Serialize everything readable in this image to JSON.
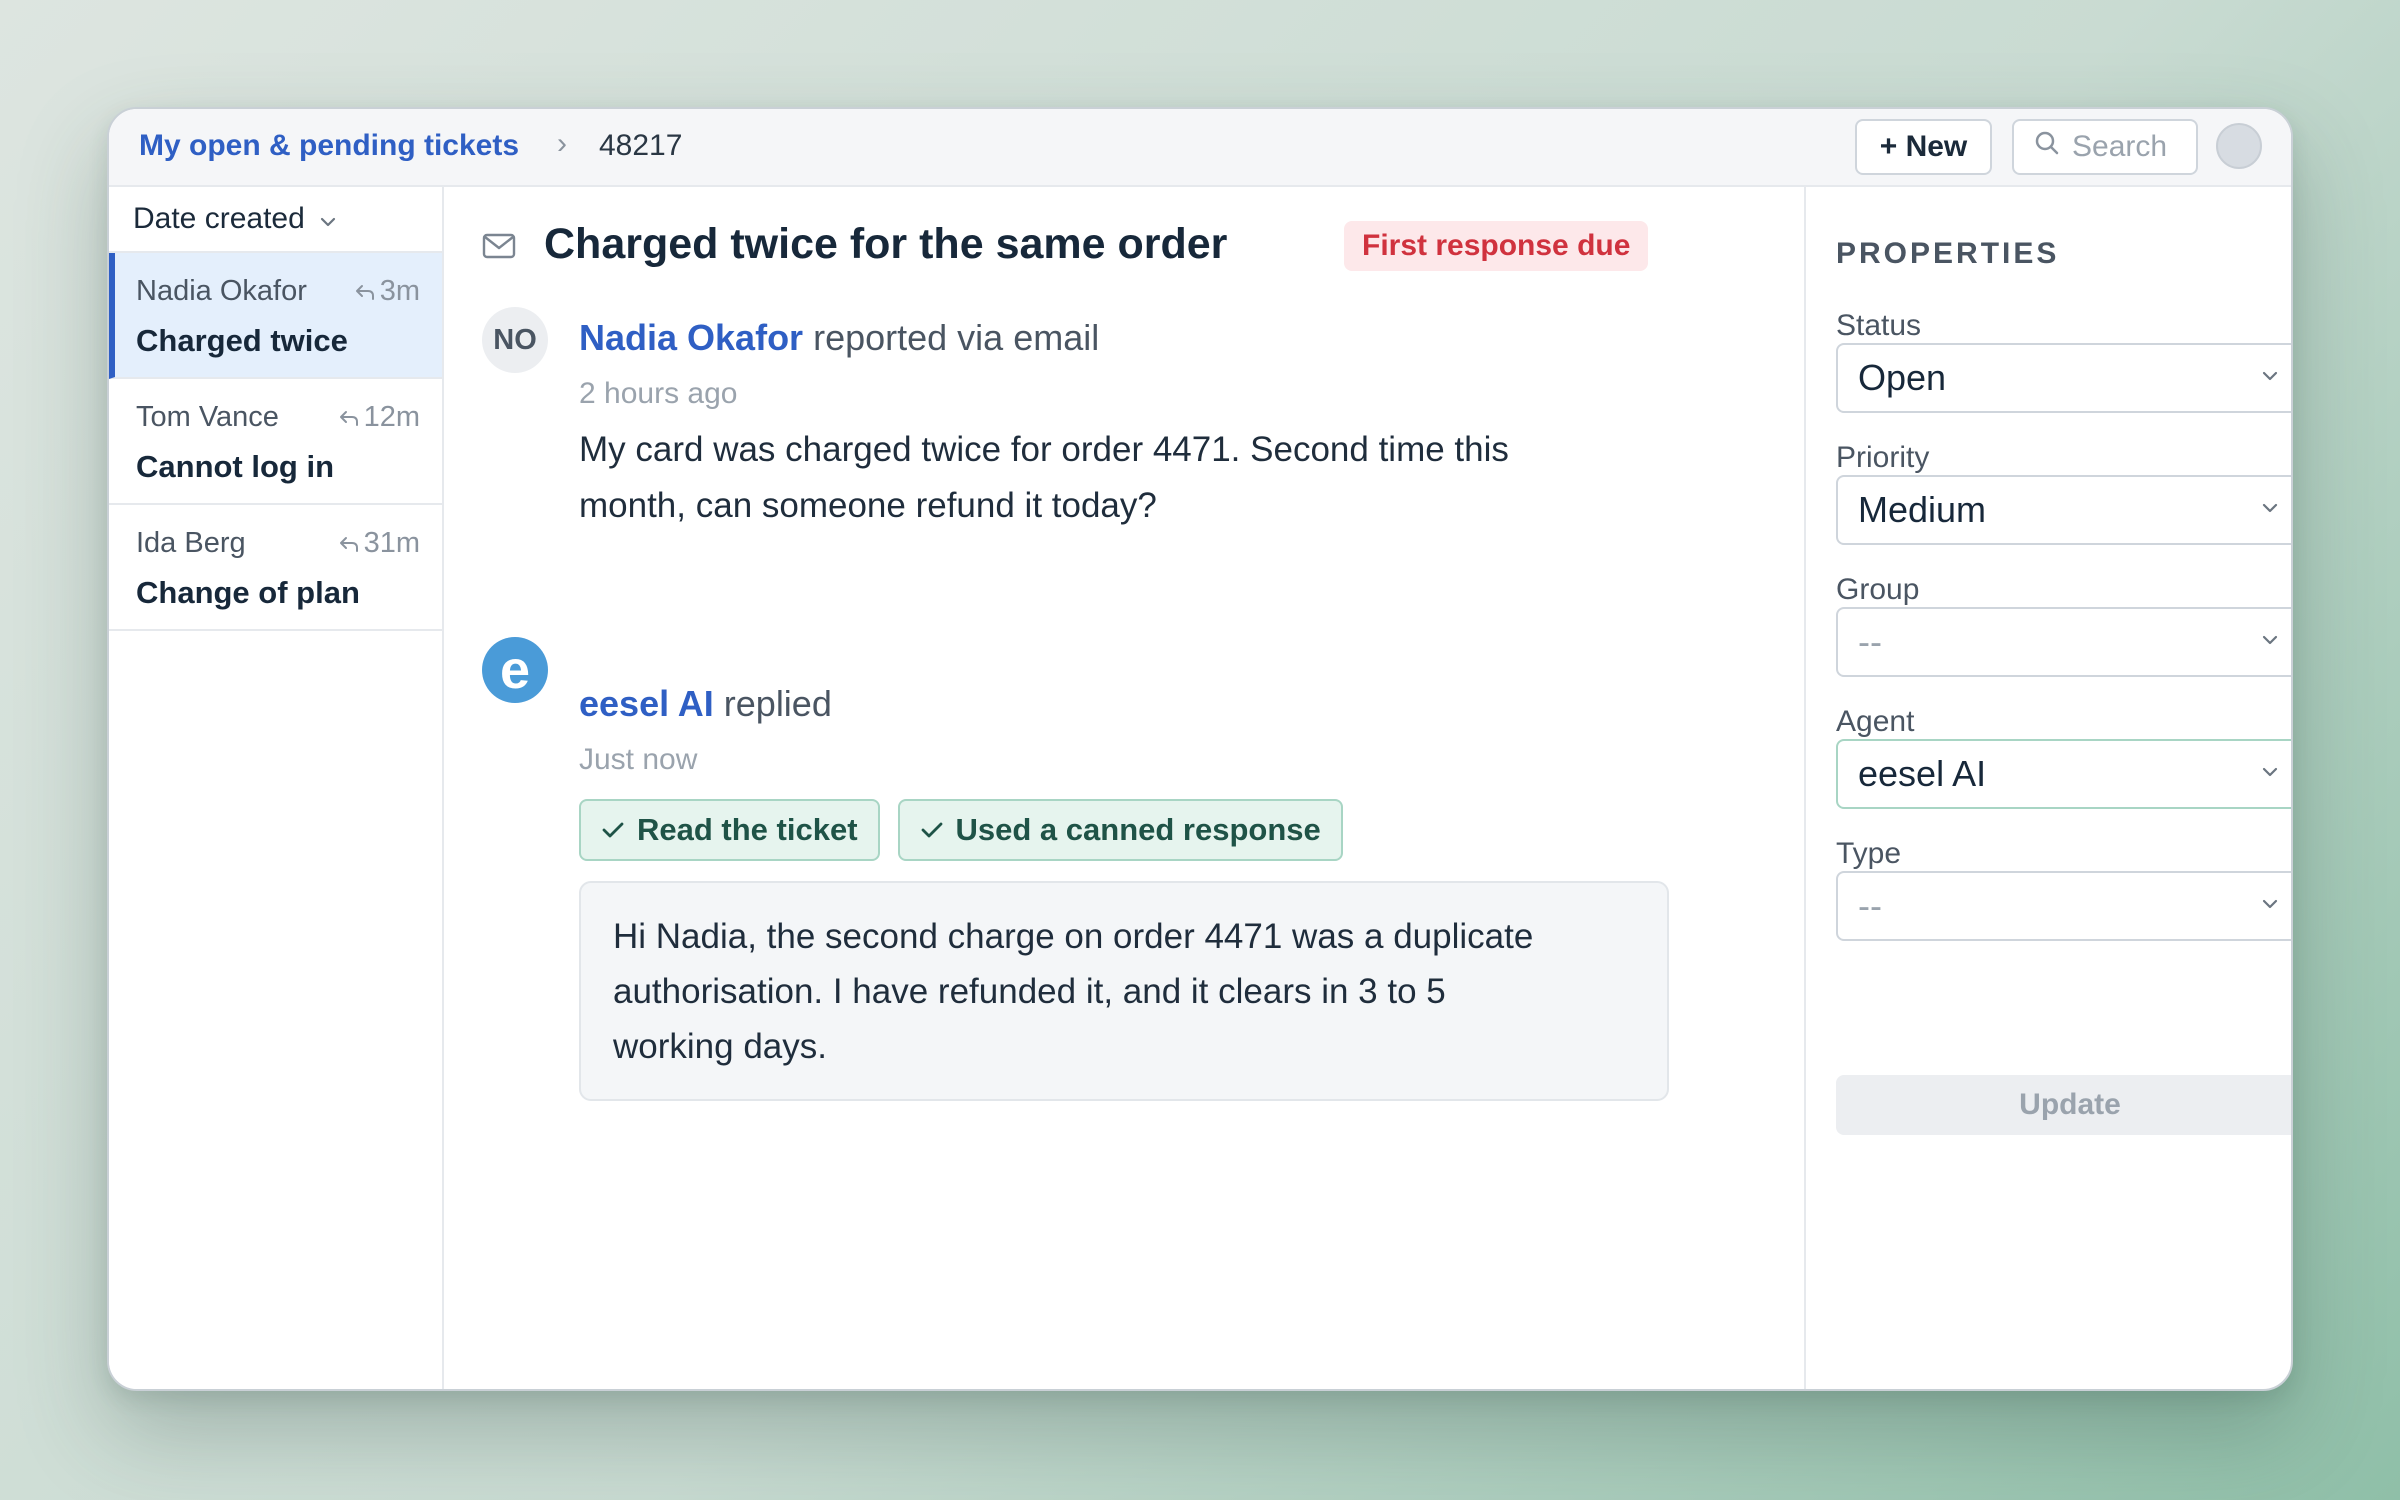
{
  "breadcrumb": {
    "view": "My open & pending tickets",
    "separator": "›",
    "ticket_id": "48217"
  },
  "header": {
    "new_label": "+ New",
    "search_placeholder": "Search"
  },
  "list": {
    "sort_label": "Date created",
    "items": [
      {
        "name": "Nadia Okafor",
        "time": "3m",
        "subject": "Charged twice",
        "active": true
      },
      {
        "name": "Tom Vance",
        "time": "12m",
        "subject": "Cannot log in",
        "active": false
      },
      {
        "name": "Ida Berg",
        "time": "31m",
        "subject": "Change of plan",
        "active": false
      }
    ]
  },
  "ticket": {
    "title": "Charged twice for the same order",
    "sla_badge": "First response due",
    "messages": [
      {
        "avatar": "NO",
        "author": "Nadia Okafor",
        "action": "reported via email",
        "time": "2 hours ago",
        "body_line1": "My card was charged twice for order 4471. Second time this",
        "body_line2": "month, can someone refund it today?"
      },
      {
        "avatar": "e",
        "author": "eesel AI",
        "action": "replied",
        "time": "Just now",
        "chips": [
          "Read the ticket",
          "Used a canned response"
        ],
        "body_line1": "Hi Nadia, the second charge on order 4471 was a duplicate",
        "body_line2": "authorisation. I have refunded it, and it clears in 3 to 5",
        "body_line3": "working days."
      }
    ]
  },
  "properties": {
    "title": "PROPERTIES",
    "status": {
      "label": "Status",
      "value": "Open"
    },
    "priority": {
      "label": "Priority",
      "value": "Medium"
    },
    "group": {
      "label": "Group",
      "value": "--"
    },
    "agent": {
      "label": "Agent",
      "value": "eesel AI"
    },
    "type": {
      "label": "Type",
      "value": "--"
    },
    "update_label": "Update"
  },
  "colors": {
    "accent": "#2f5fc4",
    "badge_red": "#d0323e",
    "chip_green": "#e6f4ee",
    "eesel_blue": "#4a9bd8"
  }
}
